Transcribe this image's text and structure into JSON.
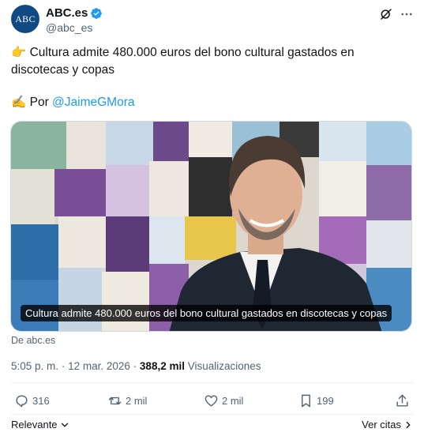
{
  "author": {
    "avatar_text": "ABC",
    "display_name": "ABC.es",
    "handle": "@abc_es"
  },
  "post": {
    "line1": "👉 Cultura admite 480.000 euros del bono cultural gastados en discotecas y copas",
    "by_prefix": "✍️ Por ",
    "by_mention": "@JaimeGMora",
    "media_caption": "Cultura admite 480.000 euros del bono cultural gastados en discotecas y copas",
    "source": "De abc.es",
    "time": "5:05 p. m.",
    "date": "12 mar. 2026",
    "separator": "·",
    "views_count": "388,2 mil",
    "views_label": "Visualizaciones"
  },
  "actions": {
    "replies": "316",
    "reposts": "2 mil",
    "likes": "2 mil",
    "bookmarks": "199"
  },
  "footer": {
    "sort_label": "Relevante",
    "quotes_label": "Ver citas"
  },
  "colors": {
    "accent": "#1d9bf0",
    "avatar_bg": "#114a83",
    "secondary_text": "#536471"
  }
}
